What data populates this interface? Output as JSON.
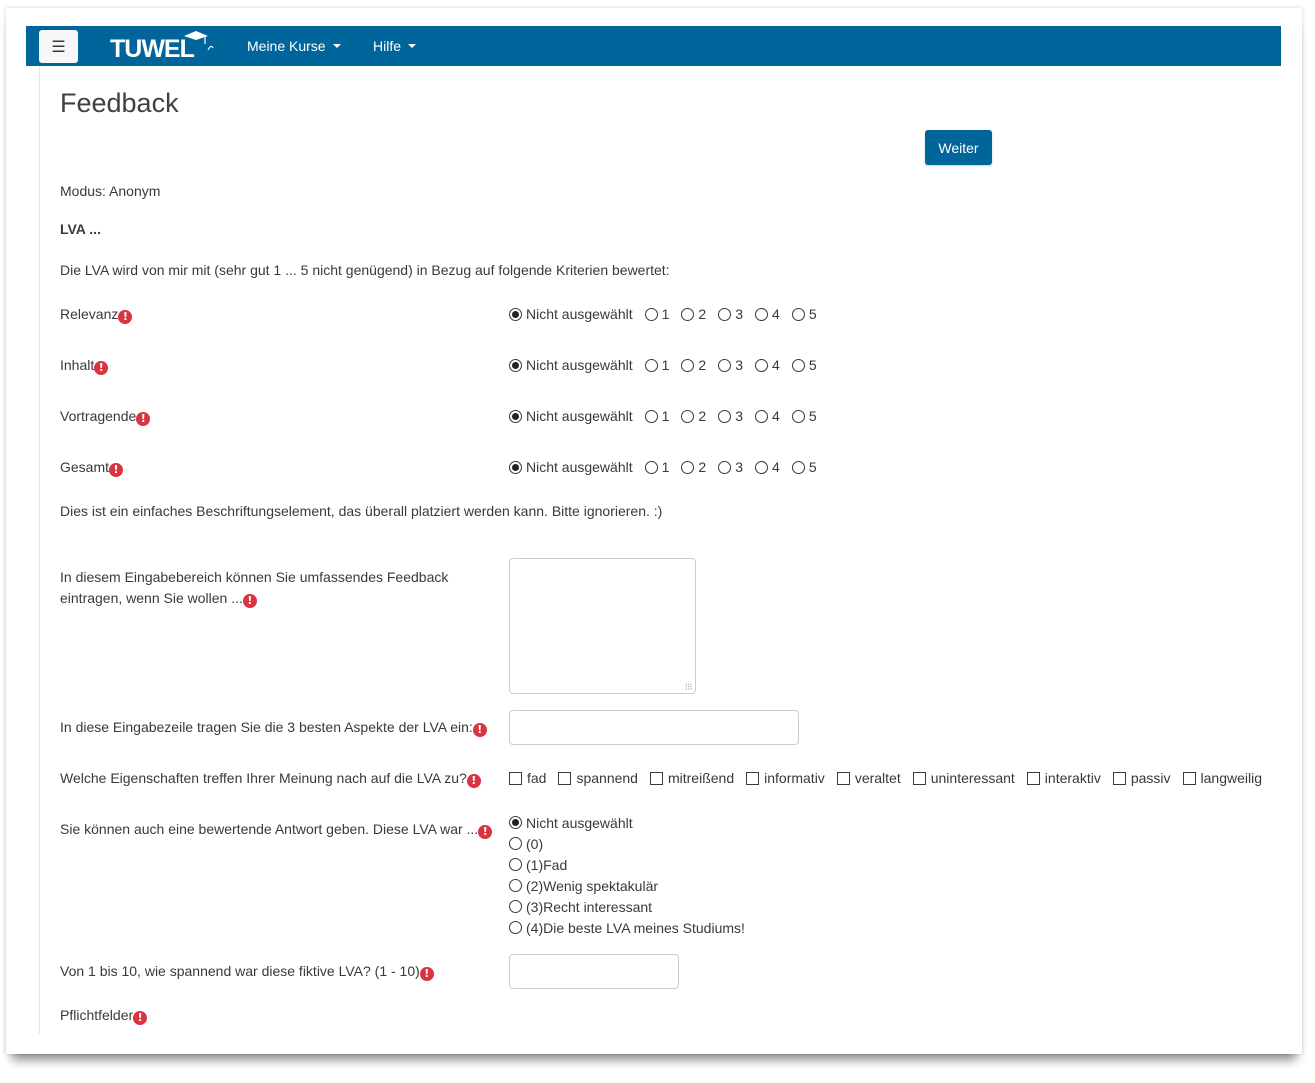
{
  "navbar": {
    "toggle_icon": "☰",
    "logo_text": "TUWEL",
    "menu": [
      {
        "label": "Meine Kurse"
      },
      {
        "label": "Hilfe"
      }
    ],
    "brand_color": "#00659b"
  },
  "page": {
    "title": "Feedback",
    "next_button": "Weiter",
    "mode": "Modus: Anonym",
    "section_heading": "LVA ...",
    "intro": "Die LVA wird von mir mit (sehr gut 1 ... 5 nicht genügend) in Bezug auf folgende Kriterien bewertet:",
    "required_icon": "!",
    "required_color": "#d9343f"
  },
  "ratings": {
    "options": [
      "Nicht ausgewählt",
      "1",
      "2",
      "3",
      "4",
      "5"
    ],
    "selected": "Nicht ausgewählt",
    "questions": [
      {
        "label": "Relevanz"
      },
      {
        "label": "Inhalt"
      },
      {
        "label": "Vortragende"
      },
      {
        "label": "Gesamt"
      }
    ]
  },
  "label_element": "Dies ist ein einfaches Beschriftungselement, das überall platziert werden kann. Bitte ignorieren. :)",
  "feedback_textarea": {
    "label_line1": "In diesem Eingabebereich können Sie umfassendes Feedback",
    "label_line2": "eintragen, wenn Sie wollen ...",
    "value": ""
  },
  "aspects_input": {
    "label": "In diese Eingabezeile tragen Sie die 3 besten Aspekte der LVA ein:",
    "value": ""
  },
  "properties": {
    "label": "Welche Eigenschaften treffen Ihrer Meinung nach auf die LVA zu?",
    "options": [
      "fad",
      "spannend",
      "mitreißend",
      "informativ",
      "veraltet",
      "uninteressant",
      "interaktiv",
      "passiv",
      "langweilig"
    ]
  },
  "evaluative": {
    "label": "Sie können auch eine bewertende Antwort geben. Diese LVA war ...",
    "options": [
      "Nicht ausgewählt",
      "(0)",
      "(1)Fad",
      "(2)Wenig spektakulär",
      "(3)Recht interessant",
      "(4)Die beste LVA meines Studiums!"
    ],
    "selected": "Nicht ausgewählt"
  },
  "scale_input": {
    "label": "Von 1 bis 10, wie spannend war diese fiktive LVA? (1 - 10)",
    "value": ""
  },
  "required_note": "Pflichtfelder"
}
